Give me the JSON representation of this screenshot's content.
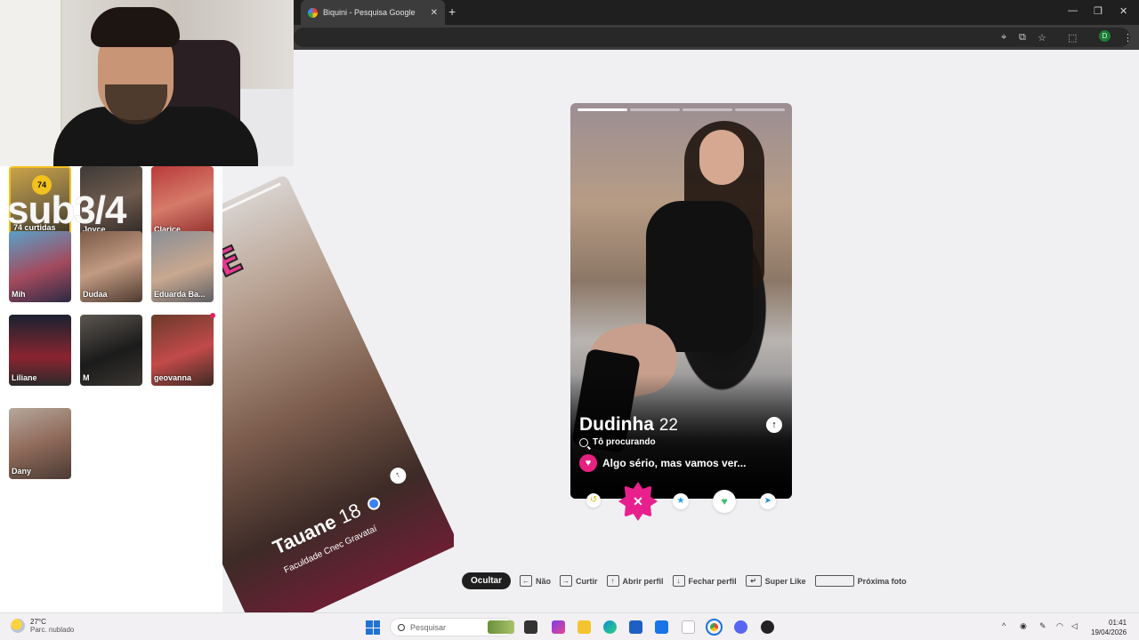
{
  "browser": {
    "tab_title": "Biquini - Pesquisa Google",
    "tab_close": "✕",
    "new_tab": "+",
    "profile_initial": "D"
  },
  "matches_panel": {
    "likes_count": "74",
    "likes_label": "74 curtidas",
    "overlay_text": "sub3/4",
    "profiles": [
      {
        "name": "Joyce"
      },
      {
        "name": "Clarice"
      },
      {
        "name": "Mih"
      },
      {
        "name": "Dudaa"
      },
      {
        "name": "Eduarda Ba..."
      },
      {
        "name": "Liliane"
      },
      {
        "name": "M"
      },
      {
        "name": "geovanna"
      },
      {
        "name": "Dany"
      }
    ]
  },
  "background_card": {
    "sticker": "NOPE",
    "name": "Tauane",
    "age": "18",
    "school": "Faculdade Cnec Gravataí"
  },
  "profile_card": {
    "name": "Dudinha",
    "age": "22",
    "looking_label": "Tô procurando",
    "goal": "Algo sério, mas vamos ver...",
    "photo_count": 4,
    "active_photo": 1
  },
  "actions": {
    "rewind_icon": "↺",
    "nope_icon": "✕",
    "super_like_icon": "★",
    "like_icon": "♥",
    "boost_icon": "➤"
  },
  "shortcuts": {
    "hide": "Ocultar",
    "nope": "Não",
    "like": "Curtir",
    "open_profile": "Abrir perfil",
    "close_profile": "Fechar perfil",
    "super_like": "Super Like",
    "next_photo": "Próxima foto"
  },
  "taskbar": {
    "temperature": "27°C",
    "weather": "Parc. nublado",
    "search_placeholder": "Pesquisar",
    "time": "01:41",
    "date": "19/04/2026"
  }
}
